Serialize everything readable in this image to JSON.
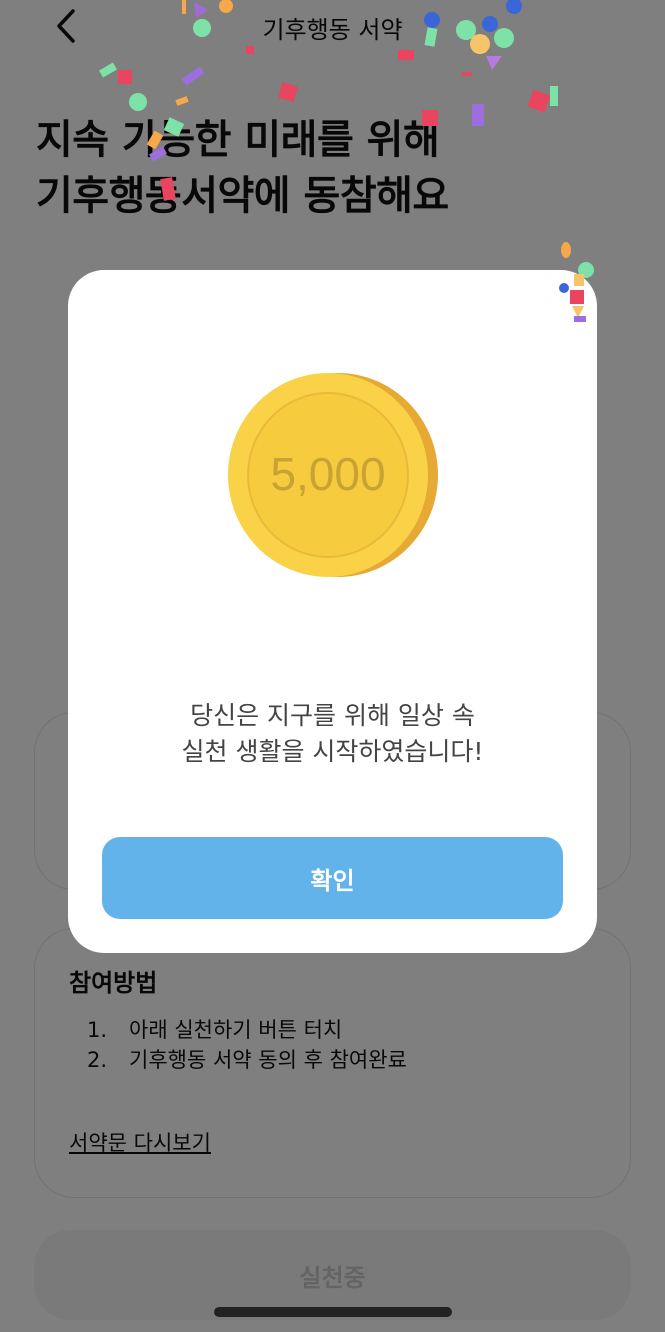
{
  "header": {
    "title": "기후행동 서약",
    "back_icon": "chevron-left-icon"
  },
  "hero": {
    "line1": "지속 가능한 미래를 위해",
    "line2": "기후행동서약에 동참해요"
  },
  "method": {
    "title": "참여방법",
    "steps": [
      {
        "num": "1.",
        "text": "아래 실천하기 버튼 터치"
      },
      {
        "num": "2.",
        "text": "기후행동 서약 동의 후 참여완료"
      }
    ],
    "link": "서약문 다시보기"
  },
  "practice_button": {
    "label": "실천중"
  },
  "modal": {
    "coin_value": "5,000",
    "message_line1": "당신은 지구를 위해 일상 속",
    "message_line2": "실천 생활을 시작하였습니다!",
    "confirm_label": "확인"
  },
  "colors": {
    "accent": "#62b3ea",
    "coin_face": "#f9d248",
    "coin_edge": "#e6a934",
    "coin_text": "#c9a236"
  }
}
